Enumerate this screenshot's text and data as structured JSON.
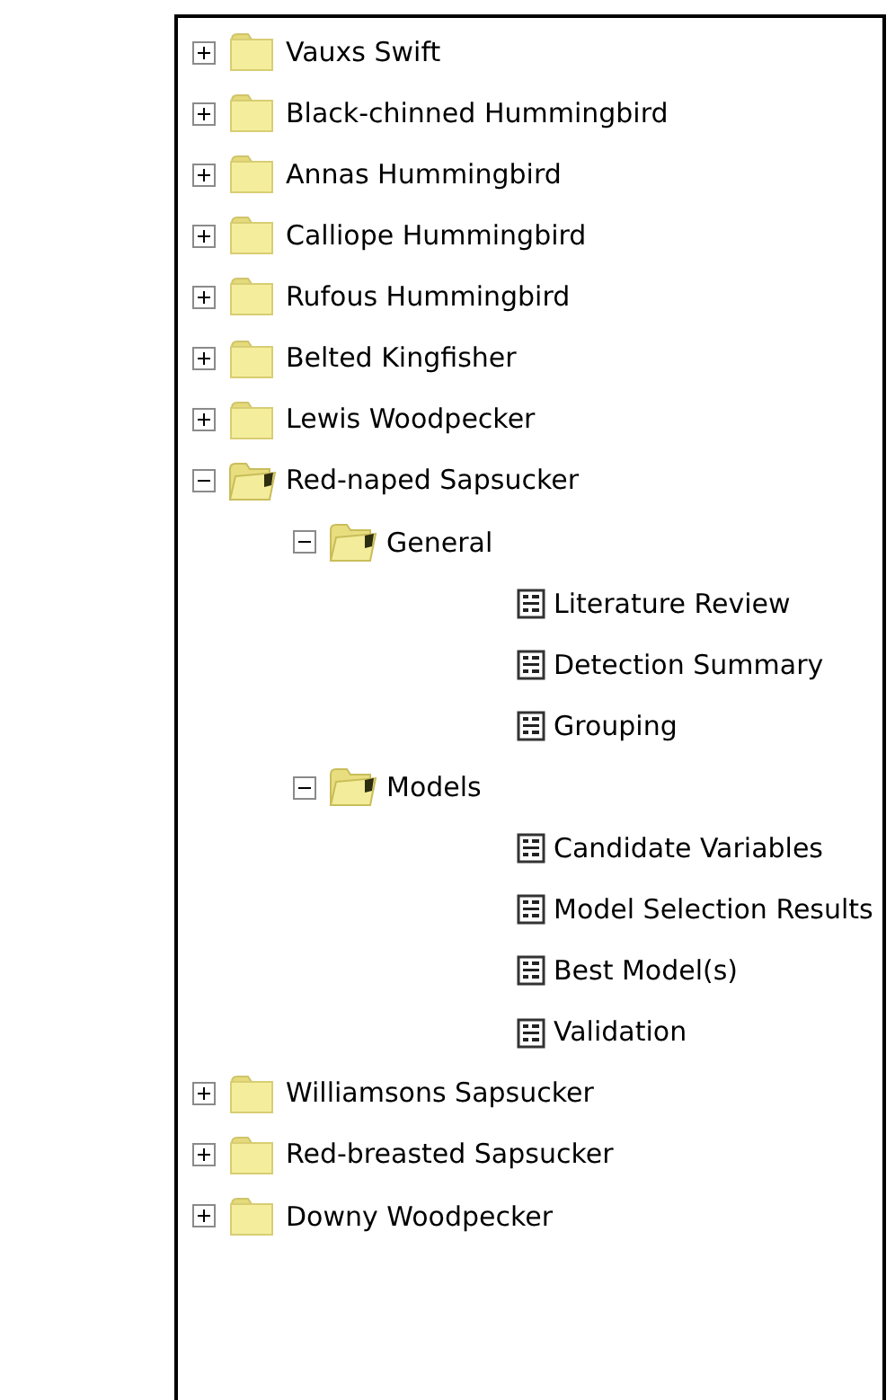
{
  "tree": [
    {
      "label": "Vauxs Swift",
      "kind": "folder",
      "expanded": false
    },
    {
      "label": "Black-chinned Hummingbird",
      "kind": "folder",
      "expanded": false
    },
    {
      "label": "Annas Hummingbird",
      "kind": "folder",
      "expanded": false
    },
    {
      "label": "Calliope Hummingbird",
      "kind": "folder",
      "expanded": false
    },
    {
      "label": "Rufous Hummingbird",
      "kind": "folder",
      "expanded": false
    },
    {
      "label": "Belted Kingfisher",
      "kind": "folder",
      "expanded": false
    },
    {
      "label": "Lewis Woodpecker",
      "kind": "folder",
      "expanded": false
    },
    {
      "label": "Red-naped Sapsucker",
      "kind": "folder",
      "expanded": true,
      "children": [
        {
          "label": "General",
          "kind": "folder",
          "expanded": true,
          "children": [
            {
              "label": "Literature Review",
              "kind": "document"
            },
            {
              "label": "Detection Summary",
              "kind": "document"
            },
            {
              "label": "Grouping",
              "kind": "document"
            }
          ]
        },
        {
          "label": "Models",
          "kind": "folder",
          "expanded": true,
          "children": [
            {
              "label": "Candidate Variables",
              "kind": "document"
            },
            {
              "label": "Model Selection Results",
              "kind": "document"
            },
            {
              "label": "Best Model(s)",
              "kind": "document"
            },
            {
              "label": "Validation",
              "kind": "document"
            }
          ]
        }
      ]
    },
    {
      "label": "Williamsons Sapsucker",
      "kind": "folder",
      "expanded": false
    },
    {
      "label": "Red-breasted Sapsucker",
      "kind": "folder",
      "expanded": false
    },
    {
      "label": "Downy Woodpecker",
      "kind": "folder",
      "expanded": false
    }
  ]
}
